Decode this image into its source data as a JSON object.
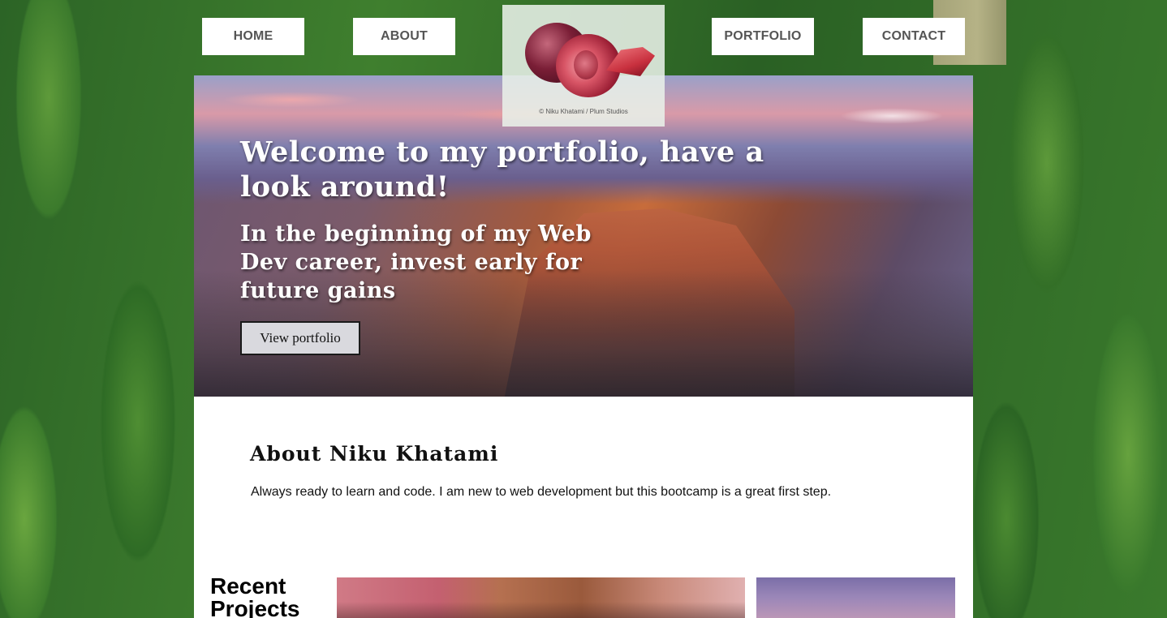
{
  "nav": {
    "items": [
      {
        "label": "HOME"
      },
      {
        "label": "ABOUT"
      },
      {
        "label": "PORTFOLIO"
      },
      {
        "label": "CONTACT"
      }
    ]
  },
  "logo": {
    "caption": "© Niku Khatami / Plum Studios"
  },
  "hero": {
    "title": "Welcome to my portfolio, have a look around!",
    "subtitle": "In the beginning of my Web Dev career, invest early for future gains",
    "button_label": "View portfolio"
  },
  "about": {
    "title": "About Niku Khatami",
    "text": "Always ready to learn and code. I am new to web development but this bootcamp is a great first step."
  },
  "recent": {
    "title": "Recent Projects"
  }
}
